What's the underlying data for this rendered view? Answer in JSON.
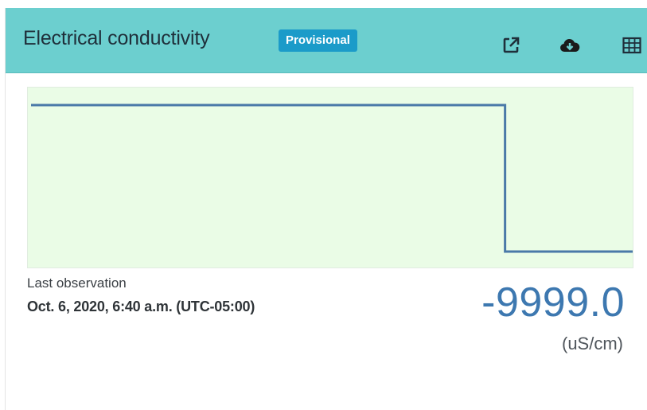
{
  "card": {
    "title": "Electrical conductivity",
    "badge": "Provisional",
    "icons": [
      "external-link-icon",
      "cloud-download-icon",
      "table-icon"
    ]
  },
  "chart_data": {
    "type": "line",
    "title": "",
    "xlabel": "",
    "ylabel": "",
    "grid": false,
    "series": [
      {
        "values": [
          1,
          1,
          1,
          1,
          1,
          1,
          1,
          1,
          1,
          1,
          1,
          1,
          1,
          1,
          1,
          1,
          1,
          1,
          1,
          1,
          1,
          1,
          1,
          1,
          1,
          1,
          1,
          1,
          1,
          1,
          1,
          1,
          1,
          1,
          1,
          1,
          1,
          1,
          1,
          1,
          1,
          1,
          1,
          1,
          1,
          1,
          1,
          1,
          1,
          1,
          1,
          1,
          1,
          1,
          1,
          1,
          1,
          1,
          1,
          1,
          1,
          1,
          1,
          1,
          1,
          1,
          1,
          1,
          1,
          1,
          1,
          1,
          1,
          1,
          1,
          1,
          1,
          1,
          0,
          0,
          0,
          0,
          0,
          0,
          0,
          0,
          0,
          0,
          0,
          0,
          0,
          0,
          0,
          0,
          0,
          0,
          0,
          0,
          0,
          0
        ]
      }
    ]
  },
  "observation": {
    "label": "Last observation",
    "time": "Oct. 6, 2020, 6:40 a.m. (UTC-05:00)",
    "value": "-9999.0",
    "unit": "(uS/cm)"
  },
  "colors": {
    "header_bg": "#6ccfcf",
    "badge_bg": "#1b9bc9",
    "chart_bg": "#eafce6",
    "line": "#4a79a8",
    "value": "#3d78b0"
  }
}
